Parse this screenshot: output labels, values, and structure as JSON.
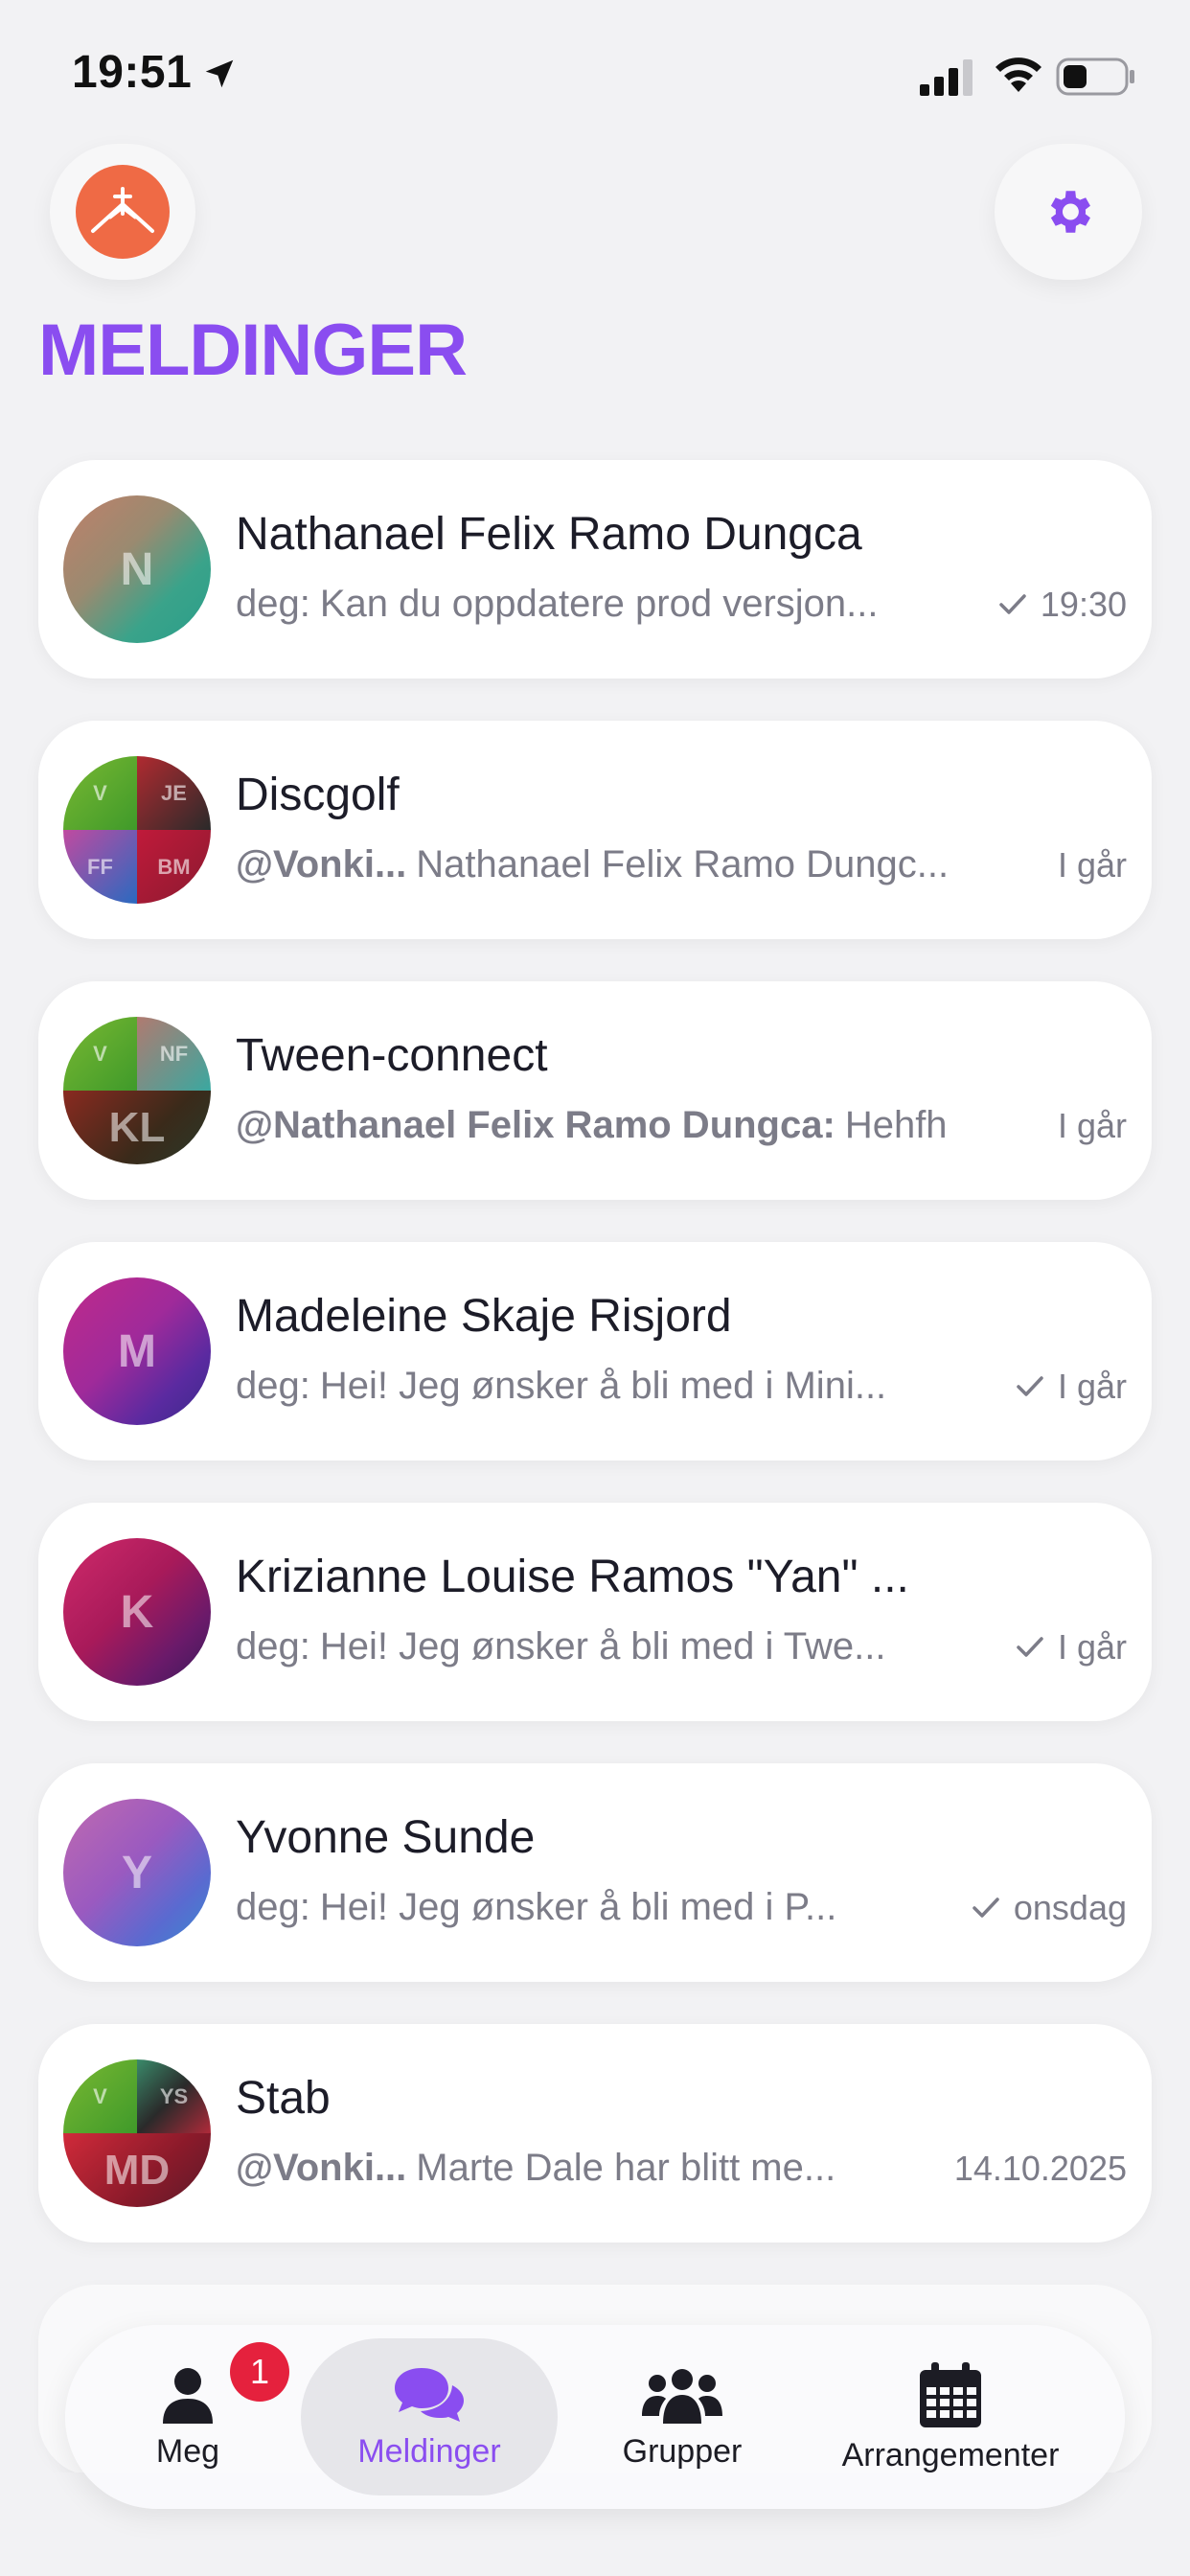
{
  "status_bar": {
    "time": "19:51"
  },
  "header": {
    "title": "MELDINGER"
  },
  "chats": [
    {
      "name": "Nathanael Felix Ramo Dungca",
      "sender": "deg:",
      "preview": "Kan du oppdatere prod versjon...",
      "time": "19:30",
      "read": true,
      "avatar": {
        "type": "single",
        "initials": "N"
      }
    },
    {
      "name": "Discgolf",
      "sender": "@Vonki...",
      "preview": "Nathanael Felix Ramo Dungc...",
      "time": "I går",
      "read": false,
      "avatar": {
        "type": "quad",
        "initials": [
          "V",
          "JE",
          "FF",
          "BM"
        ]
      }
    },
    {
      "name": "Tween-connect",
      "sender": "@Nathanael Felix Ramo Dungca:",
      "preview": "Hehfh",
      "time": "I går",
      "read": false,
      "avatar": {
        "type": "tri",
        "initials": [
          "V",
          "NF",
          "KL"
        ]
      }
    },
    {
      "name": "Madeleine Skaje Risjord",
      "sender": "deg:",
      "preview": "Hei! Jeg ønsker å bli med i Mini...",
      "time": "I går",
      "read": true,
      "avatar": {
        "type": "single",
        "initials": "M"
      }
    },
    {
      "name": "Krizianne Louise Ramos \"Yan\" ...",
      "sender": "deg:",
      "preview": "Hei! Jeg ønsker å bli med i Twe...",
      "time": "I går",
      "read": true,
      "avatar": {
        "type": "single",
        "initials": "K"
      }
    },
    {
      "name": "Yvonne Sunde",
      "sender": "deg:",
      "preview": "Hei! Jeg ønsker å bli med i P...",
      "time": "onsdag",
      "read": true,
      "avatar": {
        "type": "single",
        "initials": "Y"
      }
    },
    {
      "name": "Stab",
      "sender": "@Vonki...",
      "preview": "Marte Dale har blitt me...",
      "time": "14.10.2025",
      "read": false,
      "avatar": {
        "type": "tri",
        "initials": [
          "V",
          "YS",
          "MD"
        ]
      }
    }
  ],
  "nav": {
    "items": [
      {
        "label": "Meg",
        "icon": "person-icon",
        "badge": "1"
      },
      {
        "label": "Meldinger",
        "icon": "chat-bubbles-icon",
        "active": true
      },
      {
        "label": "Grupper",
        "icon": "group-icon"
      },
      {
        "label": "Arrangementer",
        "icon": "calendar-icon"
      }
    ]
  },
  "colors": {
    "accent": "#8a4df0",
    "badge": "#e5213d",
    "logo": "#ef6a45",
    "background": "#f2f2f4"
  }
}
